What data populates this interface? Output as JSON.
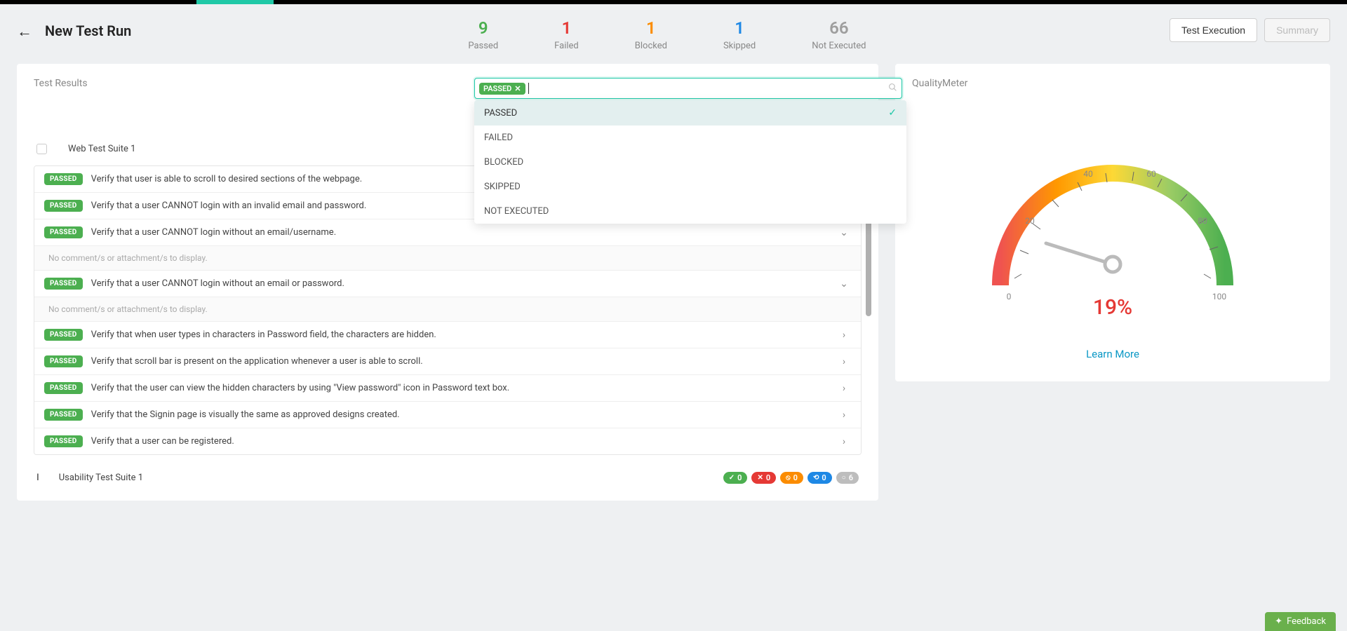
{
  "header": {
    "title": "New Test Run",
    "tabs": {
      "execution": "Test Execution",
      "summary": "Summary"
    }
  },
  "stats": {
    "passed": {
      "num": "9",
      "label": "Passed"
    },
    "failed": {
      "num": "1",
      "label": "Failed"
    },
    "blocked": {
      "num": "1",
      "label": "Blocked"
    },
    "skipped": {
      "num": "1",
      "label": "Skipped"
    },
    "notexec": {
      "num": "66",
      "label": "Not Executed"
    }
  },
  "results": {
    "panel_title": "Test Results",
    "filter_chip": "PASSED",
    "dropdown": {
      "passed": "PASSED",
      "failed": "FAILED",
      "blocked": "BLOCKED",
      "skipped": "SKIPPED",
      "notexec": "NOT EXECUTED"
    },
    "suite1": {
      "name": "Web Test Suite 1",
      "badge": "PASSED",
      "no_comment": "No comment/s or attachment/s to display.",
      "rows": {
        "r1": "Verify that user is able to scroll to desired sections of the webpage.",
        "r2": "Verify that a user CANNOT login with an invalid email and password.",
        "r3": "Verify that a user CANNOT login without an email/username.",
        "r4": "Verify that a user CANNOT login without an email or password.",
        "r5": "Verify that when user types in characters in Password field, the characters are hidden.",
        "r6": "Verify that scroll bar is present on the application whenever a user is able to scroll.",
        "r7": "Verify that the user can view the hidden characters by using \"View password\" icon in Password text box.",
        "r8": "Verify that the Signin page is visually the same as approved designs created.",
        "r9": "Verify that a user can be registered."
      }
    },
    "suite2": {
      "name": "Usability Test Suite 1",
      "pills": {
        "green": "0",
        "red": "0",
        "orange": "0",
        "blue": "0",
        "grey": "6"
      }
    }
  },
  "meter": {
    "title": "QualityMeter",
    "percent": "19%",
    "learn_more": "Learn More",
    "ticks": {
      "t0": "0",
      "t20": "20",
      "t40": "40",
      "t60": "60",
      "t80": "80",
      "t100": "100"
    }
  },
  "feedback": "Feedback",
  "chart_data": {
    "type": "gauge",
    "title": "QualityMeter",
    "value": 19,
    "min": 0,
    "max": 100,
    "ticks": [
      0,
      20,
      40,
      60,
      80,
      100
    ],
    "unit": "%"
  }
}
